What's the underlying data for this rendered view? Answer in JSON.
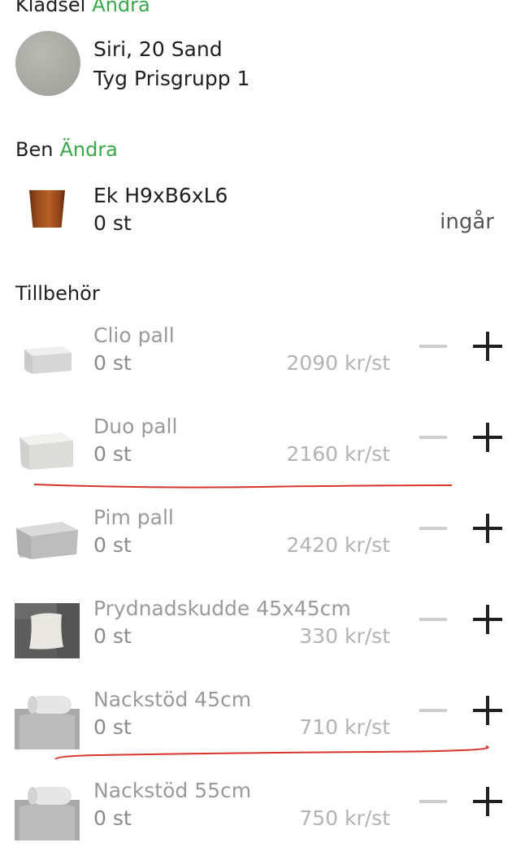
{
  "fabric": {
    "heading": "Klädsel",
    "change": "Ändra",
    "name": "Siri, 20 Sand",
    "group": "Tyg Prisgrupp 1"
  },
  "legs": {
    "heading": "Ben",
    "change": "Ändra",
    "name": "Ek H9xB6xL6",
    "qty": "0 st",
    "status": "ingår"
  },
  "accessories": {
    "heading": "Tillbehör",
    "items": [
      {
        "name": "Clio pall",
        "qty": "0 st",
        "price": "2090 kr/st",
        "icon": "footstool-clio-icon"
      },
      {
        "name": "Duo pall",
        "qty": "0 st",
        "price": "2160 kr/st",
        "icon": "footstool-duo-icon"
      },
      {
        "name": "Pim pall",
        "qty": "0 st",
        "price": "2420 kr/st",
        "icon": "footstool-pim-icon"
      },
      {
        "name": "Prydnadskudde 45x45cm",
        "qty": "0 st",
        "price": "330 kr/st",
        "icon": "cushion-icon"
      },
      {
        "name": "Nackstöd 45cm",
        "qty": "0 st",
        "price": "710 kr/st",
        "icon": "headrest-icon"
      },
      {
        "name": "Nackstöd 55cm",
        "qty": "0 st",
        "price": "750 kr/st",
        "icon": "headrest-icon"
      }
    ]
  },
  "colors": {
    "accent_green": "#3aa84a",
    "annotation_red": "#d9342b"
  }
}
